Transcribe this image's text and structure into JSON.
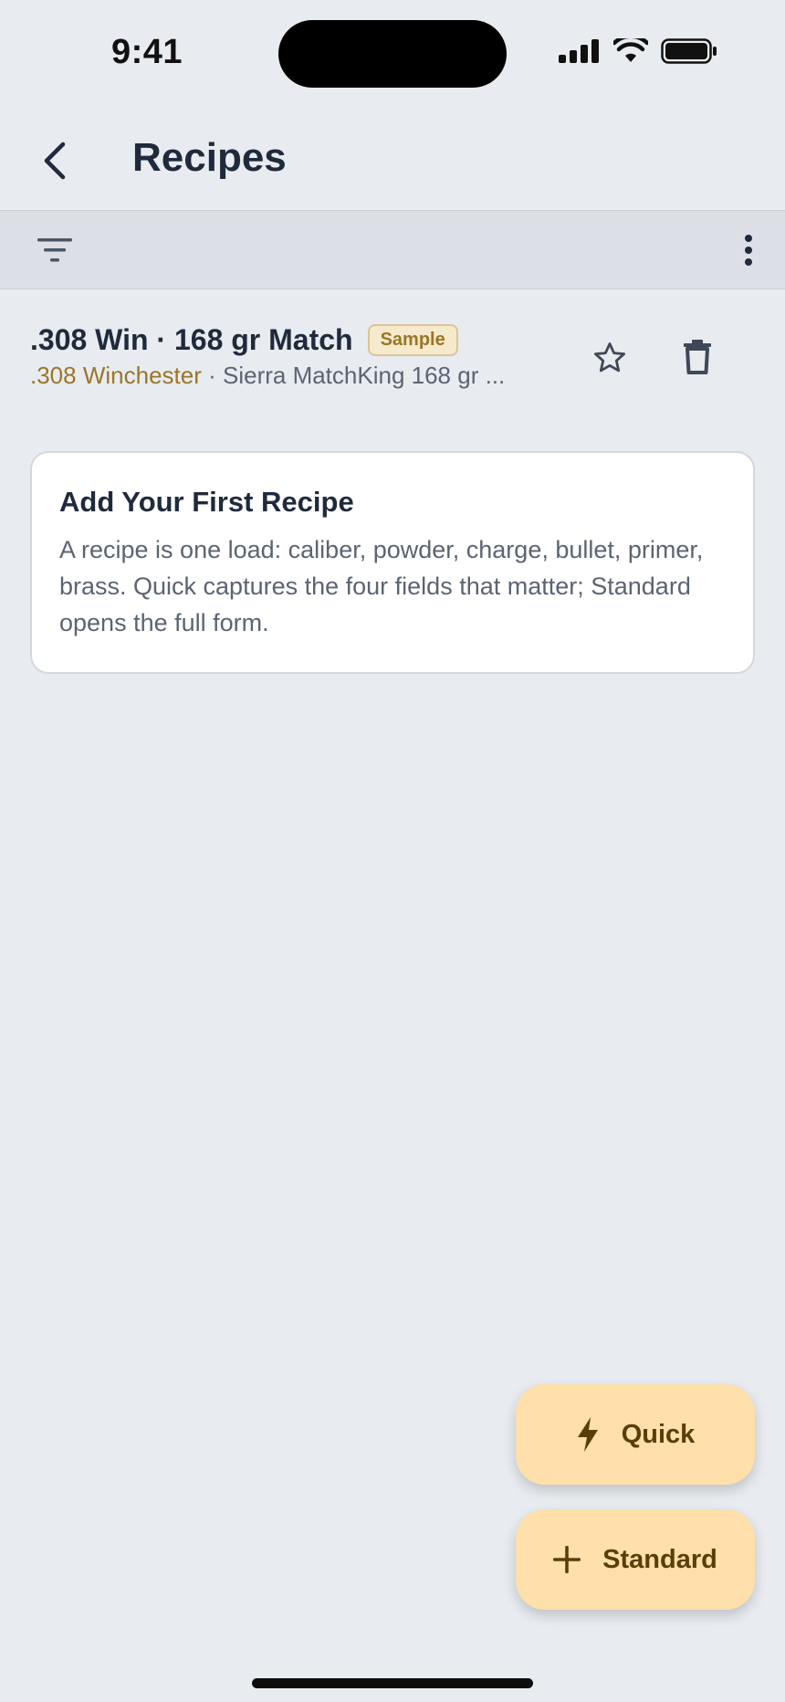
{
  "status_bar": {
    "time": "9:41"
  },
  "app_bar": {
    "title": "Recipes"
  },
  "recipes": [
    {
      "title": ".308 Win · 168 gr Match",
      "badge": "Sample",
      "caliber": ".308 Winchester",
      "separator": " · ",
      "bullet": "Sierra MatchKing 168 gr ..."
    }
  ],
  "info_card": {
    "title": "Add Your First Recipe",
    "body": "A recipe is one load: caliber, powder, charge, bullet, primer, brass. Quick captures the four fields that matter; Standard opens the full form."
  },
  "fabs": {
    "quick_label": "Quick",
    "standard_label": "Standard"
  },
  "icons": {
    "back": "chevron-left-icon",
    "filter": "filter-icon",
    "more": "more-vertical-icon",
    "favorite": "star-outline-icon",
    "delete": "trash-icon",
    "quick": "lightning-bolt-icon",
    "standard": "plus-icon"
  },
  "colors": {
    "background": "#E8ECF0",
    "toolbar": "#DCE0E6",
    "accent": "#9A7628",
    "fab": "#FFDFAA",
    "fab_text": "#5A3E0A"
  }
}
